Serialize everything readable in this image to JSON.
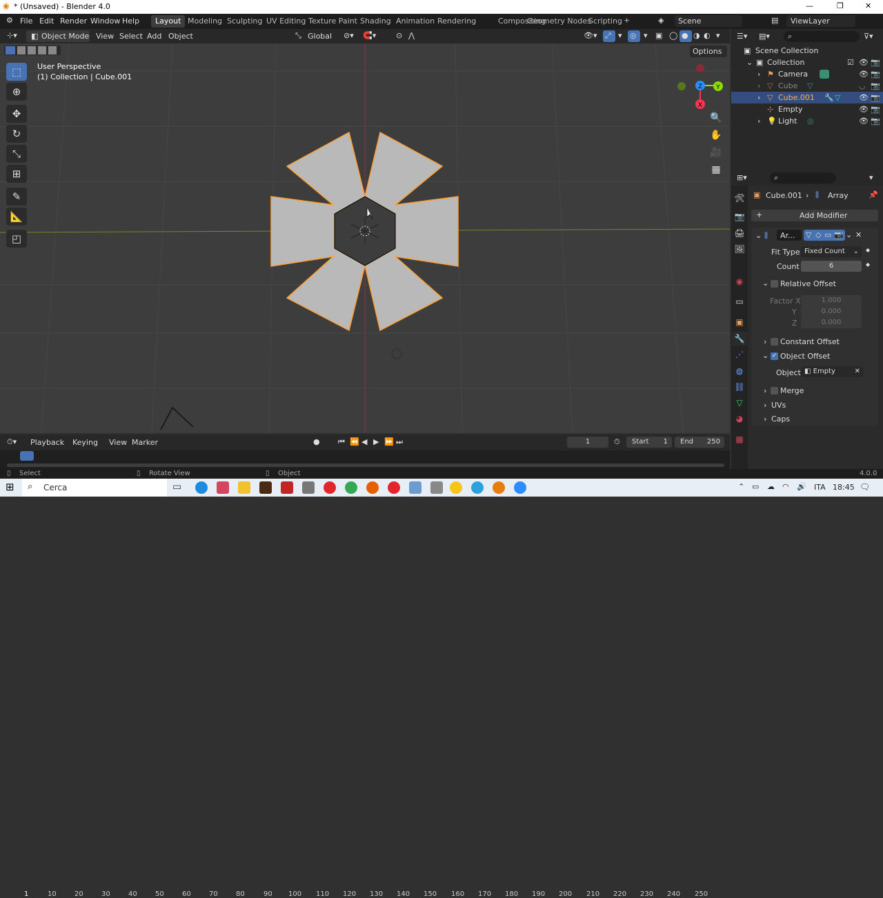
{
  "window": {
    "title": "* (Unsaved) - Blender 4.0",
    "minimize": "—",
    "maximize": "❐",
    "close": "✕"
  },
  "menu": [
    "File",
    "Edit",
    "Render",
    "Window",
    "Help"
  ],
  "workspaces": [
    "Layout",
    "Modeling",
    "Sculpting",
    "UV Editing",
    "Texture Paint",
    "Shading",
    "Animation",
    "Rendering",
    "Compositing",
    "Geometry Nodes",
    "Scripting"
  ],
  "scene": {
    "name": "Scene",
    "viewlayer": "ViewLayer"
  },
  "viewport_header": {
    "mode": "Object Mode",
    "view": "View",
    "select": "Select",
    "add": "Add",
    "object": "Object",
    "orientation": "Global",
    "options": "Options"
  },
  "viewport": {
    "perspective": "User Perspective",
    "collection_info": "(1) Collection | Cube.001"
  },
  "gizmo": {
    "x": "X",
    "y": "Y",
    "z": "Z"
  },
  "outliner": {
    "root": "Scene Collection",
    "collection": "Collection",
    "items": [
      "Camera",
      "Cube",
      "Cube.001",
      "Empty",
      "Light"
    ]
  },
  "properties": {
    "breadcrumb_object": "Cube.001",
    "breadcrumb_modifier": "Array",
    "add_modifier": "Add Modifier",
    "modifier_name": "Ar...",
    "fit_type_label": "Fit Type",
    "fit_type_value": "Fixed Count",
    "count_label": "Count",
    "count_value": "6",
    "relative_offset": "Relative Offset",
    "factor_x_label": "Factor X",
    "factor_x": "1.000",
    "y_label": "Y",
    "y_value": "0.000",
    "z_label": "Z",
    "z_value": "0.000",
    "constant_offset": "Constant Offset",
    "object_offset": "Object Offset",
    "object_label": "Object",
    "object_value": "Empty",
    "merge": "Merge",
    "uvs": "UVs",
    "caps": "Caps"
  },
  "timeline": {
    "playback": "Playback",
    "keying": "Keying",
    "view": "View",
    "marker": "Marker",
    "current_frame": "1",
    "start_label": "Start",
    "start": "1",
    "end_label": "End",
    "end": "250",
    "ticks": [
      "1",
      "10",
      "20",
      "30",
      "40",
      "50",
      "60",
      "70",
      "80",
      "90",
      "100",
      "110",
      "120",
      "130",
      "140",
      "150",
      "160",
      "170",
      "180",
      "190",
      "200",
      "210",
      "220",
      "230",
      "240",
      "250"
    ]
  },
  "status": {
    "select": "Select",
    "rotate": "Rotate View",
    "object": "Object",
    "version": "4.0.0"
  },
  "taskbar": {
    "search": "Cerca",
    "lang": "ITA",
    "time": "18:45"
  },
  "colors": {
    "accent": "#4772b3",
    "selection": "#ffa033",
    "x_axis": "#ff3352",
    "y_axis": "#8bdc00",
    "z_axis": "#2890ff"
  }
}
